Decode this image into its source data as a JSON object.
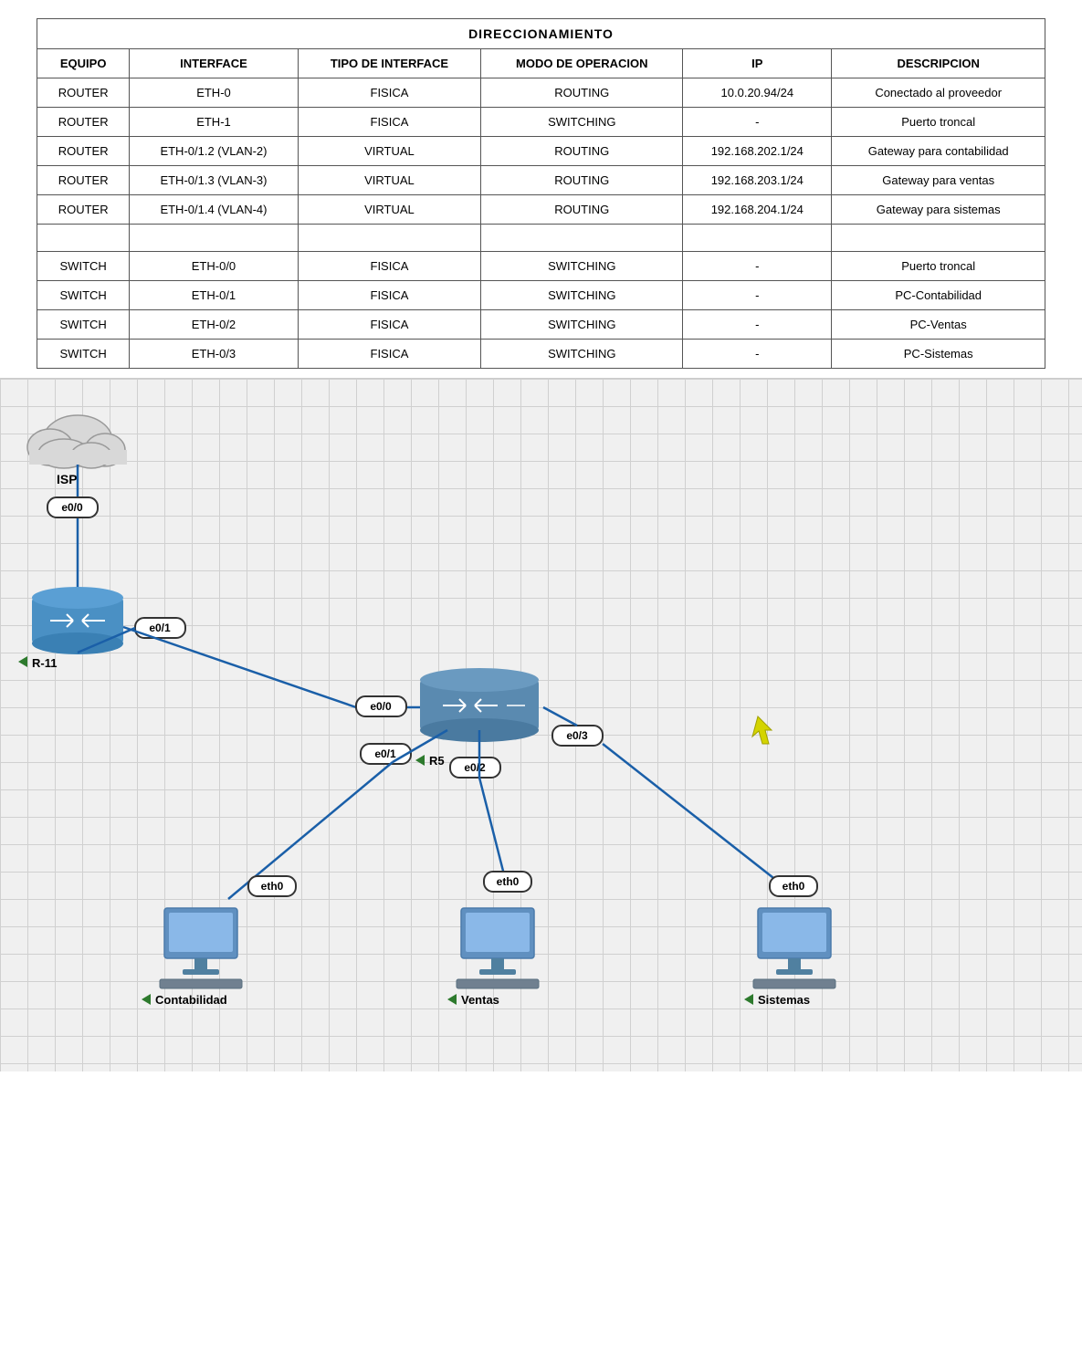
{
  "table": {
    "title": "DIRECCIONAMIENTO",
    "headers": [
      "EQUIPO",
      "INTERFACE",
      "TIPO DE INTERFACE",
      "MODO DE OPERACION",
      "IP",
      "DESCRIPCION"
    ],
    "rows": [
      [
        "ROUTER",
        "ETH-0",
        "FISICA",
        "ROUTING",
        "10.0.20.94/24",
        "Conectado al proveedor"
      ],
      [
        "ROUTER",
        "ETH-1",
        "FISICA",
        "SWITCHING",
        "-",
        "Puerto troncal"
      ],
      [
        "ROUTER",
        "ETH-0/1.2 (VLAN-2)",
        "VIRTUAL",
        "ROUTING",
        "192.168.202.1/24",
        "Gateway para contabilidad"
      ],
      [
        "ROUTER",
        "ETH-0/1.3 (VLAN-3)",
        "VIRTUAL",
        "ROUTING",
        "192.168.203.1/24",
        "Gateway para ventas"
      ],
      [
        "ROUTER",
        "ETH-0/1.4 (VLAN-4)",
        "VIRTUAL",
        "ROUTING",
        "192.168.204.1/24",
        "Gateway para sistemas"
      ],
      [
        "",
        "",
        "",
        "",
        "",
        ""
      ],
      [
        "SWITCH",
        "ETH-0/0",
        "FISICA",
        "SWITCHING",
        "-",
        "Puerto troncal"
      ],
      [
        "SWITCH",
        "ETH-0/1",
        "FISICA",
        "SWITCHING",
        "-",
        "PC-Contabilidad"
      ],
      [
        "SWITCH",
        "ETH-0/2",
        "FISICA",
        "SWITCHING",
        "-",
        "PC-Ventas"
      ],
      [
        "SWITCH",
        "ETH-0/3",
        "FISICA",
        "SWITCHING",
        "-",
        "PC-Sistemas"
      ]
    ]
  },
  "diagram": {
    "isp_label": "ISP",
    "r11_label": "R-11",
    "r5_label": "R5",
    "contabilidad_label": "Contabilidad",
    "ventas_label": "Ventas",
    "sistemas_label": "Sistemas",
    "bubbles": {
      "e00_r11": "e0/0",
      "e01_r11": "e0/1",
      "e00_r5": "e0/0",
      "e01_r5": "e0/1",
      "e02_r5": "e0/2",
      "e03_r5": "e0/3",
      "eth0_cont": "eth0",
      "eth0_ventas": "eth0",
      "eth0_sist": "eth0"
    }
  }
}
